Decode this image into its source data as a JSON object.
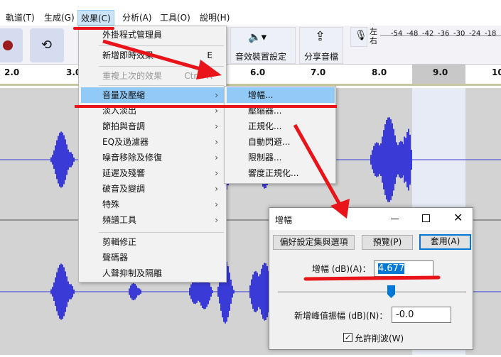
{
  "menubar": [
    "軌道(T)",
    "生成(G)",
    "效果(C)",
    "分析(A)",
    "工具(O)",
    "說明(H)"
  ],
  "toolbar": {
    "audio_setup": "音效裝置設定",
    "share_audio": "分享音檔",
    "meter_left": "左",
    "meter_right": "右",
    "meter_ticks": [
      "-54",
      "-48",
      "-42",
      "-36",
      "-30",
      "-24",
      "-18"
    ]
  },
  "ruler": [
    "2.0",
    "3.0",
    "6.0",
    "7.0",
    "8.0",
    "9.0",
    "10"
  ],
  "effects_menu": {
    "plugin_manager": "外掛程式管理員",
    "add_realtime": "新增即時效果",
    "add_realtime_shortcut": "E",
    "repeat_last": "重複上次的效果",
    "repeat_last_shortcut": "Ctrl+R",
    "groups": [
      "音量及壓縮",
      "淡入淡出",
      "節拍與音調",
      "EQ及過濾器",
      "噪音移除及修復",
      "延遲及殘響",
      "破音及變調",
      "特殊",
      "頻譜工具"
    ],
    "tail": [
      "剪輯修正",
      "聲碼器",
      "人聲抑制及隔離"
    ]
  },
  "submenu": [
    "增幅...",
    "壓縮器...",
    "正規化...",
    "自動閃避...",
    "限制器...",
    "響度正規化..."
  ],
  "dialog": {
    "title": "增幅",
    "presets": "偏好設定集與選項",
    "preview": "預覽(P)",
    "apply": "套用(A)",
    "gain_label": "增幅 (dB)(A)：",
    "gain_value": "4.677",
    "peak_label": "新增峰值振幅 (dB)(N)：",
    "peak_value": "-0.0",
    "allow_clip": "允許削波(W)",
    "allow_clip_checked": true,
    "slider_fraction": 0.6
  },
  "colors": {
    "wave": "#3a3ad6",
    "highlight": "#91c9f7",
    "annotation": "#e8141a"
  }
}
